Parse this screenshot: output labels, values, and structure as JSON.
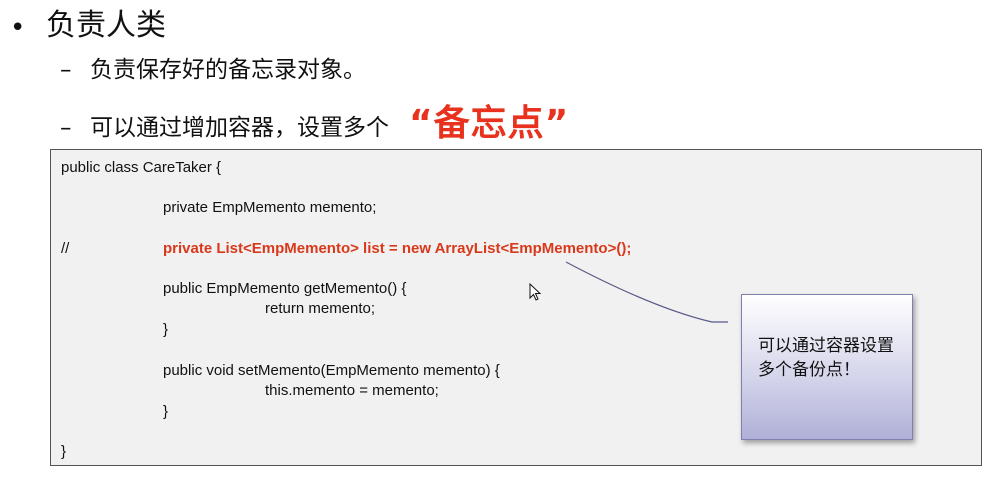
{
  "heading": {
    "bullet": "•",
    "title": "负责人类"
  },
  "subpoints": [
    {
      "dash": "–",
      "text": "负责保存好的备忘录对象。"
    },
    {
      "dash": "–",
      "text": "可以通过增加容器，设置多个",
      "highlight": "“备忘点”"
    }
  ],
  "code": {
    "lines": [
      "public class CareTaker {",
      "private EmpMemento memento;",
      "//",
      "private List<EmpMemento>  list = new ArrayList<EmpMemento>();",
      "public EmpMemento getMemento() {",
      "return memento;",
      "}",
      "public void setMemento(EmpMemento memento) {",
      "this.memento = memento;",
      "}",
      "}"
    ]
  },
  "callout": {
    "text": "可以通过容器设置多个备份点！"
  },
  "colors": {
    "highlight": "#e8321e",
    "code_red": "#d9391b",
    "connector": "#5a5a8a"
  }
}
